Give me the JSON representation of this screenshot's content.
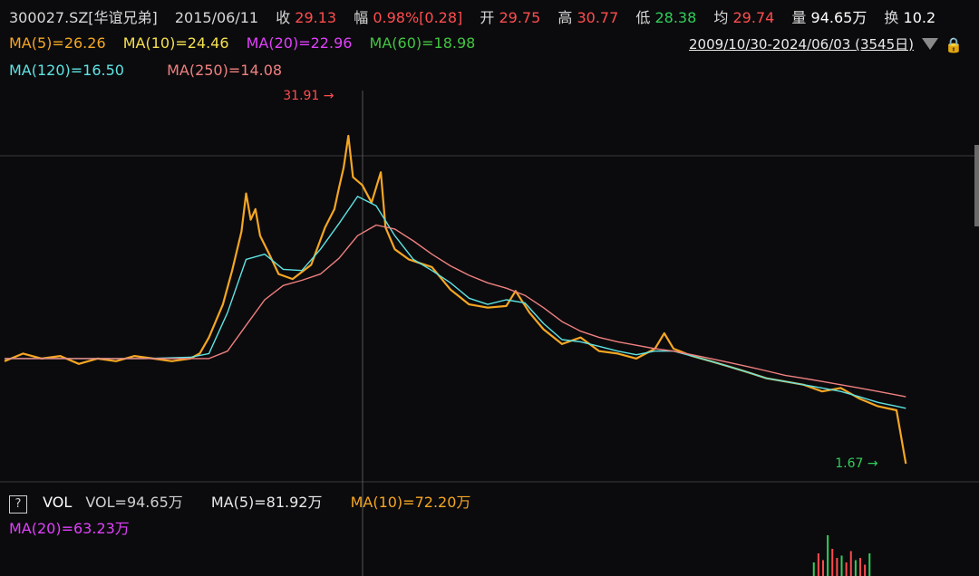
{
  "header": {
    "code": "300027.SZ[华谊兄弟]",
    "date": "2015/06/11",
    "close_label": "收",
    "close": "29.13",
    "amp_label": "幅",
    "amp": "0.98%[0.28]",
    "open_label": "开",
    "open": "29.75",
    "high_label": "高",
    "high": "30.77",
    "low_label": "低",
    "low": "28.38",
    "avg_label": "均",
    "avg": "29.74",
    "vol_label": "量",
    "vol": "94.65万",
    "turn_label": "换",
    "turn": "10.2"
  },
  "ma": {
    "ma5": "MA(5)=26.26",
    "ma10": "MA(10)=24.46",
    "ma20": "MA(20)=22.96",
    "ma60": "MA(60)=18.98",
    "ma120": "MA(120)=16.50",
    "ma250": "MA(250)=14.08"
  },
  "range_text": "2009/10/30-2024/06/03 (3545日)",
  "volume": {
    "help": "?",
    "name": "VOL",
    "vol": "VOL=94.65万",
    "ma5": "MA(5)=81.92万",
    "ma10": "MA(10)=72.20万",
    "ma20": "MA(20)=63.23万"
  },
  "colors": {
    "ma5": "#f5a623",
    "ma10": "#f4e04d",
    "ma20": "#e040fb",
    "ma60": "#43c443",
    "ma120": "#5fe3e3",
    "ma250": "#f08080",
    "up": "#ff4d4f",
    "down": "#2fcf5a"
  },
  "chart_data": {
    "type": "line",
    "x_range": [
      "2009/10/30",
      "2024/06/03"
    ],
    "y_log": true,
    "annotations": [
      {
        "text": "31.91",
        "x": 0.37,
        "y": 31.91
      },
      {
        "text": "1.67",
        "x": 0.97,
        "y": 1.67
      }
    ],
    "series": [
      {
        "name": "MA(5)",
        "color": "#f5a623",
        "points": [
          [
            0.0,
            4.2
          ],
          [
            0.02,
            4.5
          ],
          [
            0.04,
            4.3
          ],
          [
            0.06,
            4.4
          ],
          [
            0.08,
            4.1
          ],
          [
            0.1,
            4.3
          ],
          [
            0.12,
            4.2
          ],
          [
            0.14,
            4.4
          ],
          [
            0.16,
            4.3
          ],
          [
            0.18,
            4.2
          ],
          [
            0.2,
            4.3
          ],
          [
            0.21,
            4.5
          ],
          [
            0.22,
            5.2
          ],
          [
            0.235,
            7.0
          ],
          [
            0.245,
            9.5
          ],
          [
            0.255,
            13.5
          ],
          [
            0.26,
            19.0
          ],
          [
            0.265,
            15.0
          ],
          [
            0.27,
            16.5
          ],
          [
            0.275,
            13.0
          ],
          [
            0.285,
            11.0
          ],
          [
            0.295,
            9.2
          ],
          [
            0.31,
            8.8
          ],
          [
            0.33,
            10.0
          ],
          [
            0.345,
            14.0
          ],
          [
            0.355,
            16.5
          ],
          [
            0.36,
            20.0
          ],
          [
            0.365,
            24.0
          ],
          [
            0.37,
            31.9
          ],
          [
            0.375,
            22.0
          ],
          [
            0.385,
            20.5
          ],
          [
            0.395,
            17.5
          ],
          [
            0.405,
            23.0
          ],
          [
            0.41,
            14.0
          ],
          [
            0.42,
            11.5
          ],
          [
            0.435,
            10.5
          ],
          [
            0.46,
            9.8
          ],
          [
            0.48,
            8.0
          ],
          [
            0.5,
            7.0
          ],
          [
            0.52,
            6.8
          ],
          [
            0.54,
            6.9
          ],
          [
            0.55,
            7.9
          ],
          [
            0.565,
            6.5
          ],
          [
            0.58,
            5.6
          ],
          [
            0.6,
            4.9
          ],
          [
            0.62,
            5.2
          ],
          [
            0.64,
            4.6
          ],
          [
            0.66,
            4.5
          ],
          [
            0.68,
            4.3
          ],
          [
            0.7,
            4.7
          ],
          [
            0.71,
            5.4
          ],
          [
            0.72,
            4.7
          ],
          [
            0.74,
            4.4
          ],
          [
            0.76,
            4.2
          ],
          [
            0.78,
            4.0
          ],
          [
            0.8,
            3.8
          ],
          [
            0.82,
            3.6
          ],
          [
            0.84,
            3.5
          ],
          [
            0.86,
            3.4
          ],
          [
            0.88,
            3.2
          ],
          [
            0.9,
            3.3
          ],
          [
            0.92,
            3.0
          ],
          [
            0.94,
            2.8
          ],
          [
            0.96,
            2.7
          ],
          [
            0.97,
            1.67
          ]
        ]
      },
      {
        "name": "MA(60)",
        "color": "#5fe3e3",
        "points": [
          [
            0.0,
            4.3
          ],
          [
            0.05,
            4.3
          ],
          [
            0.1,
            4.3
          ],
          [
            0.15,
            4.3
          ],
          [
            0.2,
            4.35
          ],
          [
            0.22,
            4.5
          ],
          [
            0.24,
            6.5
          ],
          [
            0.26,
            10.5
          ],
          [
            0.28,
            11.0
          ],
          [
            0.3,
            9.6
          ],
          [
            0.32,
            9.5
          ],
          [
            0.34,
            11.5
          ],
          [
            0.36,
            14.5
          ],
          [
            0.38,
            18.5
          ],
          [
            0.4,
            17.0
          ],
          [
            0.42,
            13.0
          ],
          [
            0.44,
            10.5
          ],
          [
            0.46,
            9.5
          ],
          [
            0.48,
            8.5
          ],
          [
            0.5,
            7.4
          ],
          [
            0.52,
            7.0
          ],
          [
            0.54,
            7.3
          ],
          [
            0.56,
            7.1
          ],
          [
            0.58,
            5.9
          ],
          [
            0.6,
            5.1
          ],
          [
            0.62,
            5.0
          ],
          [
            0.64,
            4.8
          ],
          [
            0.66,
            4.6
          ],
          [
            0.68,
            4.45
          ],
          [
            0.7,
            4.6
          ],
          [
            0.72,
            4.6
          ],
          [
            0.74,
            4.4
          ],
          [
            0.76,
            4.2
          ],
          [
            0.78,
            4.0
          ],
          [
            0.8,
            3.8
          ],
          [
            0.82,
            3.6
          ],
          [
            0.84,
            3.5
          ],
          [
            0.86,
            3.4
          ],
          [
            0.88,
            3.3
          ],
          [
            0.9,
            3.2
          ],
          [
            0.92,
            3.05
          ],
          [
            0.94,
            2.9
          ],
          [
            0.96,
            2.8
          ],
          [
            0.97,
            2.75
          ]
        ]
      },
      {
        "name": "MA(250)",
        "color": "#f08080",
        "points": [
          [
            0.0,
            4.3
          ],
          [
            0.05,
            4.3
          ],
          [
            0.1,
            4.3
          ],
          [
            0.15,
            4.3
          ],
          [
            0.2,
            4.3
          ],
          [
            0.22,
            4.3
          ],
          [
            0.24,
            4.6
          ],
          [
            0.26,
            5.8
          ],
          [
            0.28,
            7.3
          ],
          [
            0.3,
            8.3
          ],
          [
            0.32,
            8.7
          ],
          [
            0.34,
            9.2
          ],
          [
            0.36,
            10.6
          ],
          [
            0.38,
            13.0
          ],
          [
            0.4,
            14.3
          ],
          [
            0.42,
            13.8
          ],
          [
            0.44,
            12.4
          ],
          [
            0.46,
            11.0
          ],
          [
            0.48,
            9.9
          ],
          [
            0.5,
            9.1
          ],
          [
            0.52,
            8.5
          ],
          [
            0.54,
            8.1
          ],
          [
            0.56,
            7.6
          ],
          [
            0.58,
            6.8
          ],
          [
            0.6,
            6.0
          ],
          [
            0.62,
            5.5
          ],
          [
            0.64,
            5.2
          ],
          [
            0.66,
            5.0
          ],
          [
            0.68,
            4.85
          ],
          [
            0.7,
            4.7
          ],
          [
            0.72,
            4.6
          ],
          [
            0.74,
            4.45
          ],
          [
            0.76,
            4.3
          ],
          [
            0.78,
            4.15
          ],
          [
            0.8,
            4.0
          ],
          [
            0.82,
            3.85
          ],
          [
            0.84,
            3.7
          ],
          [
            0.86,
            3.6
          ],
          [
            0.88,
            3.5
          ],
          [
            0.9,
            3.4
          ],
          [
            0.92,
            3.3
          ],
          [
            0.94,
            3.2
          ],
          [
            0.96,
            3.1
          ],
          [
            0.97,
            3.05
          ]
        ]
      }
    ],
    "volume_bars": [
      [
        0.87,
        0.3
      ],
      [
        0.875,
        0.5
      ],
      [
        0.88,
        0.35
      ],
      [
        0.885,
        0.9
      ],
      [
        0.89,
        0.6
      ],
      [
        0.895,
        0.4
      ],
      [
        0.9,
        0.45
      ],
      [
        0.905,
        0.3
      ],
      [
        0.91,
        0.55
      ],
      [
        0.915,
        0.35
      ],
      [
        0.92,
        0.4
      ],
      [
        0.925,
        0.25
      ],
      [
        0.93,
        0.5
      ]
    ]
  }
}
